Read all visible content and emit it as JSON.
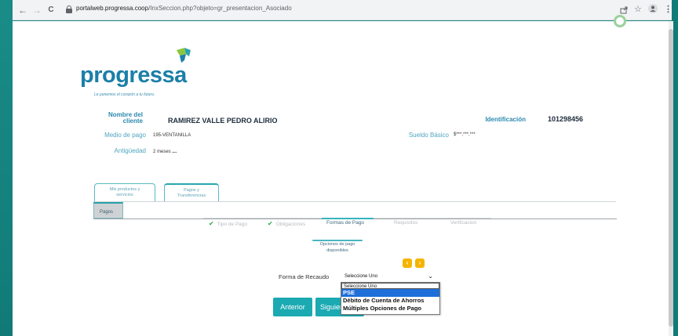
{
  "browser": {
    "back": "←",
    "forward": "→",
    "reload": "C",
    "url_host": "portalweb.progressa.coop",
    "url_path": "/InxSeccion.php?objeto=gr_presentacion_Asociado",
    "share_icon": "share-icon",
    "star_icon": "star-icon",
    "profile_icon": "profile-icon",
    "menu_icon": "menu-icon"
  },
  "brand": {
    "name": "progressa",
    "slogan": "Le ponemos el corazón a tu futuro.",
    "color": "#1b7fa8",
    "accent": "#29a3ad"
  },
  "client": {
    "name_label": "Nombre del cliente",
    "name_label_1": "Nombre del",
    "name_label_2": "cliente",
    "name_value": "RAMIREZ VALLE PEDRO ALIRIO",
    "id_label": "Identificación",
    "id_value": "101298456",
    "payment_label": "Medio de pago",
    "payment_value": "195-VENTANILLA",
    "salary_label": "Sueldo Básico",
    "salary_value": "$***,***,***",
    "seniority_label": "Antigüedad",
    "seniority_value": "2 meses",
    "seniority_dots": "..."
  },
  "tabs": {
    "products_1": "Mis productos y",
    "products_2": "servicios",
    "payments_1": "Pagos y",
    "payments_2": "Transferencias",
    "sub_tab": "Pagos"
  },
  "steps": [
    {
      "label": "Tipo de Pago",
      "done": true
    },
    {
      "label": "Obligaciones",
      "done": true
    },
    {
      "label": "Formas de Pago",
      "current": true
    },
    {
      "label": "Requisitos"
    },
    {
      "label": "Verificacion"
    }
  ],
  "options": {
    "title_1": "Opciones de pago",
    "title_2": "disponibles",
    "prev_arrow": "‹",
    "next_arrow": "›"
  },
  "form": {
    "label": "Forma de Recaudo",
    "selected": "Seleccione Uno",
    "options": [
      "Seleccione Uno",
      "PSE",
      "Débito de Cuenta de Ahorros",
      "Múltiples Opciones de Pago"
    ],
    "highlighted_index": 1
  },
  "buttons": {
    "back": "Anterior",
    "next": "Siguiente"
  }
}
